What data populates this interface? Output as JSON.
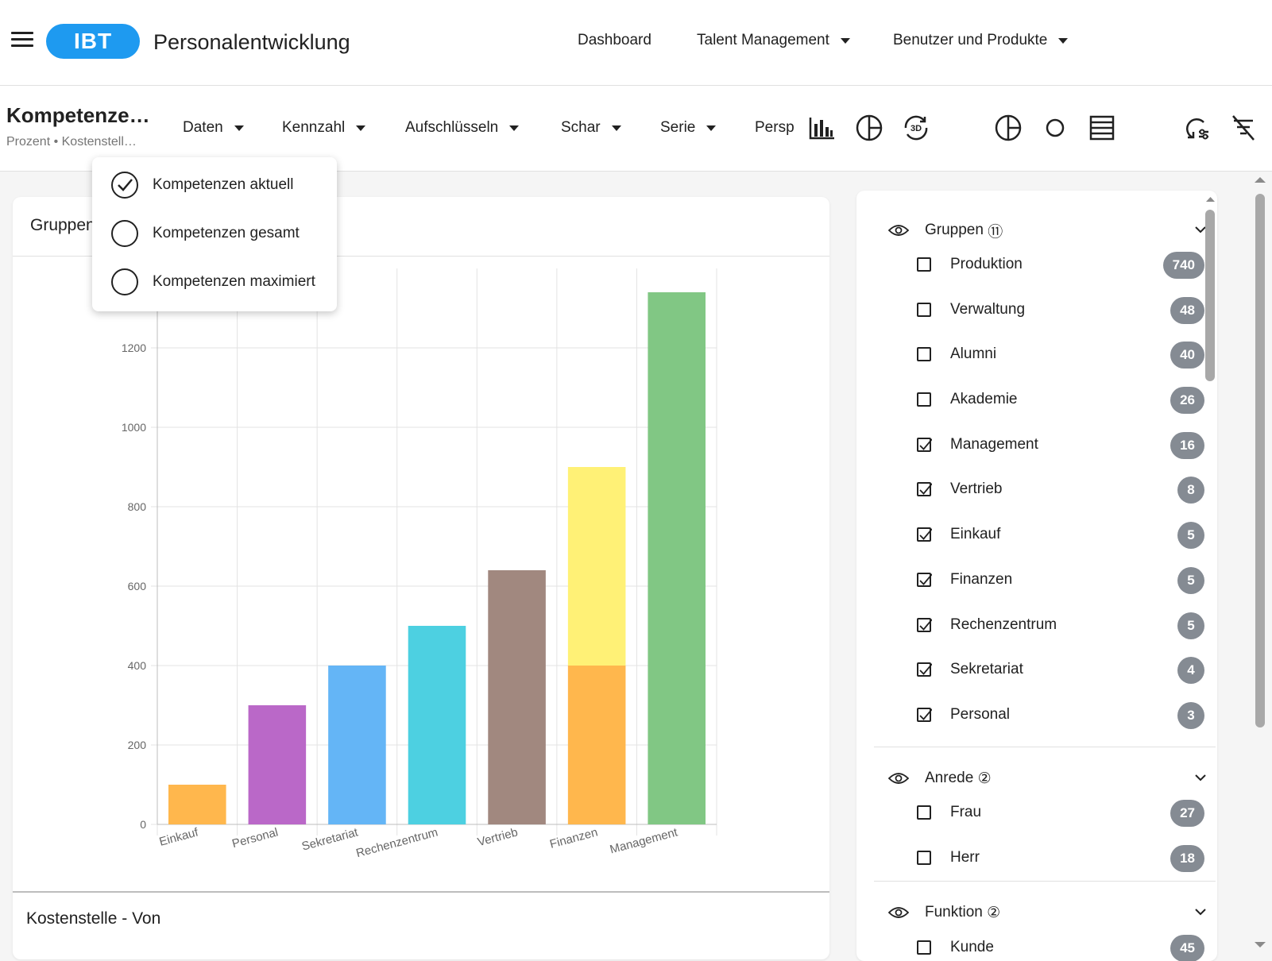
{
  "header": {
    "logo": "IBT",
    "title": "Personalentwicklung",
    "nav": [
      "Dashboard",
      "Talent Management",
      "Benutzer und Produkte"
    ]
  },
  "toolbar": {
    "title": "Kompetenze…",
    "subtitle": "Prozent • Kostenstell…",
    "menus": [
      "Daten",
      "Kennzahl",
      "Aufschlüsseln",
      "Schar",
      "Serie"
    ],
    "persp_label": "Persp"
  },
  "dropdown": {
    "items": [
      {
        "label": "Kompetenzen aktuell",
        "checked": true
      },
      {
        "label": "Kompetenzen gesamt",
        "checked": false
      },
      {
        "label": "Kompetenzen maximiert",
        "checked": false
      }
    ]
  },
  "card": {
    "header": "Gruppen",
    "footer": "Kostenstelle - Von"
  },
  "chart_data": {
    "type": "bar",
    "stacked": true,
    "categories": [
      "Einkauf",
      "Personal",
      "Sekretariat",
      "Rechenzentrum",
      "Vertrieb",
      "Finanzen",
      "Management"
    ],
    "yticks": [
      0,
      200,
      400,
      600,
      800,
      1000,
      1200
    ],
    "ylim": [
      0,
      1400
    ],
    "grid": true,
    "segments": [
      {
        "category": "Einkauf",
        "from": 0,
        "to": 100,
        "color": "#ffb74d"
      },
      {
        "category": "Personal",
        "from": 0,
        "to": 300,
        "color": "#ba68c8"
      },
      {
        "category": "Sekretariat",
        "from": 0,
        "to": 400,
        "color": "#64b5f6"
      },
      {
        "category": "Rechenzentrum",
        "from": 0,
        "to": 500,
        "color": "#4dd0e1"
      },
      {
        "category": "Vertrieb",
        "from": 0,
        "to": 640,
        "color": "#a1887f"
      },
      {
        "category": "Finanzen",
        "from": 0,
        "to": 400,
        "color": "#ffb74d"
      },
      {
        "category": "Finanzen",
        "from": 400,
        "to": 900,
        "color": "#fff176"
      },
      {
        "category": "Management",
        "from": 0,
        "to": 1340,
        "color": "#81c784"
      }
    ]
  },
  "filters": {
    "groups": [
      {
        "title": "Gruppen",
        "count_symbol": "⑪",
        "items": [
          {
            "label": "Produktion",
            "count": "740",
            "checked": false
          },
          {
            "label": "Verwaltung",
            "count": "48",
            "checked": false
          },
          {
            "label": "Alumni",
            "count": "40",
            "checked": false
          },
          {
            "label": "Akademie",
            "count": "26",
            "checked": false
          },
          {
            "label": "Management",
            "count": "16",
            "checked": true
          },
          {
            "label": "Vertrieb",
            "count": "8",
            "checked": true
          },
          {
            "label": "Einkauf",
            "count": "5",
            "checked": true
          },
          {
            "label": "Finanzen",
            "count": "5",
            "checked": true
          },
          {
            "label": "Rechenzentrum",
            "count": "5",
            "checked": true
          },
          {
            "label": "Sekretariat",
            "count": "4",
            "checked": true
          },
          {
            "label": "Personal",
            "count": "3",
            "checked": true
          }
        ]
      },
      {
        "title": "Anrede",
        "count_symbol": "②",
        "items": [
          {
            "label": "Frau",
            "count": "27",
            "checked": false
          },
          {
            "label": "Herr",
            "count": "18",
            "checked": false
          }
        ]
      },
      {
        "title": "Funktion",
        "count_symbol": "②",
        "items": [
          {
            "label": "Kunde",
            "count": "45",
            "checked": false
          }
        ]
      }
    ]
  }
}
